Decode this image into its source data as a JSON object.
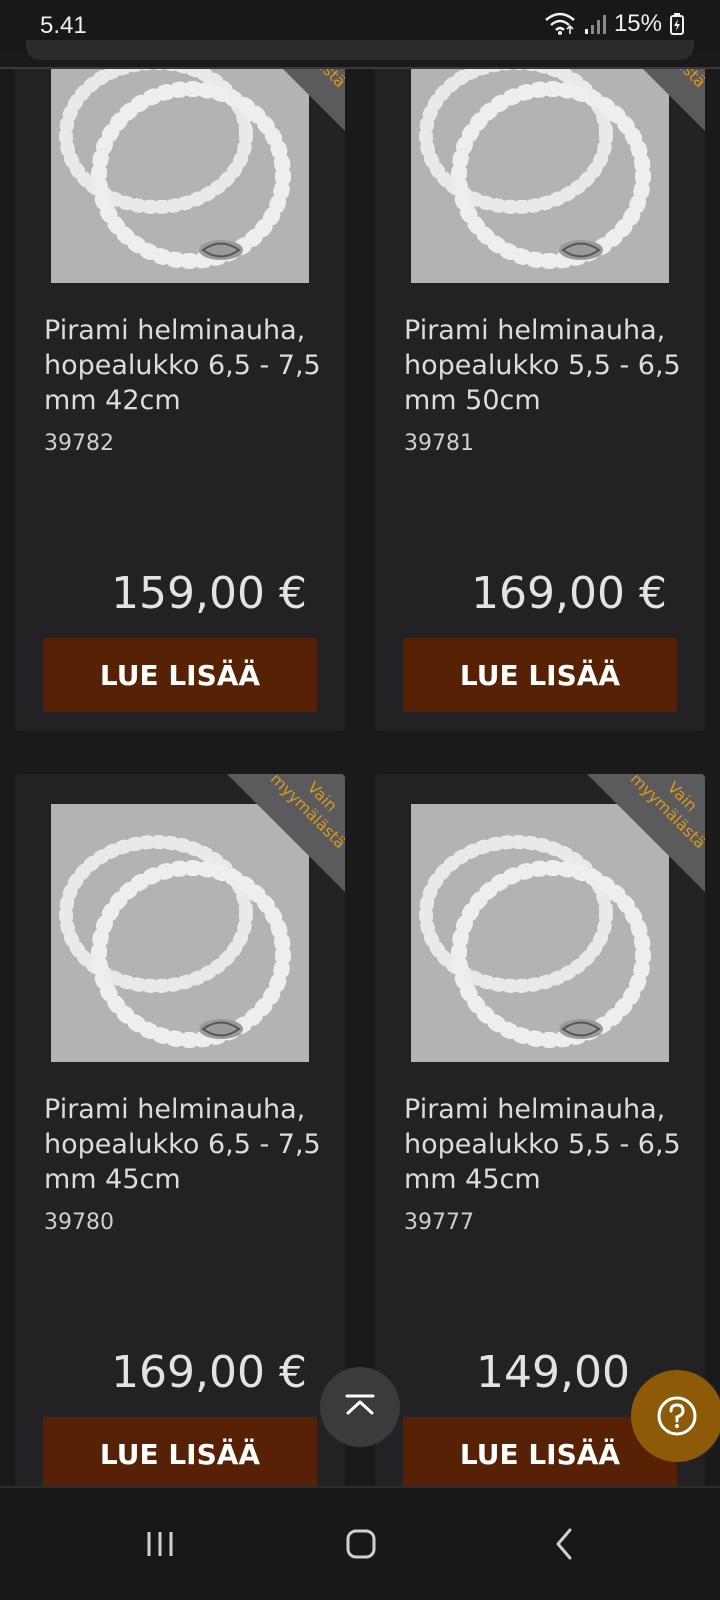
{
  "status_bar": {
    "time": "5.41",
    "battery": "15%"
  },
  "products": [
    {
      "badge": "Vain myymälästä",
      "title": "Pirami helminauha, hopealukko 6,5 - 7,5 mm 42cm",
      "sku": "39782",
      "price": "159,00 €",
      "button_label": "LUE LISÄÄ"
    },
    {
      "badge": "Vain myymälästä",
      "title": "Pirami helminauha, hopealukko 5,5 - 6,5 mm 50cm",
      "sku": "39781",
      "price": "169,00 €",
      "button_label": "LUE LISÄÄ"
    },
    {
      "badge": "Vain myymälästä",
      "title": "Pirami helminauha, hopealukko 6,5 - 7,5 mm 45cm",
      "sku": "39780",
      "price": "169,00 €",
      "button_label": "LUE LISÄÄ"
    },
    {
      "badge": "Vain myymälästä",
      "title": "Pirami helminauha, hopealukko 5,5 - 6,5 mm 45cm",
      "sku": "39777",
      "price": "149,00",
      "button_label": "LUE LISÄÄ"
    }
  ],
  "floating": {
    "scroll_top_icon": "chevron-up-bar-icon",
    "help_icon": "question-mark-icon"
  },
  "colors": {
    "background": "#1a1a1b",
    "card": "#222224",
    "button": "#562104",
    "badge_text": "#d99a1a",
    "help_button": "#8d5a07"
  }
}
